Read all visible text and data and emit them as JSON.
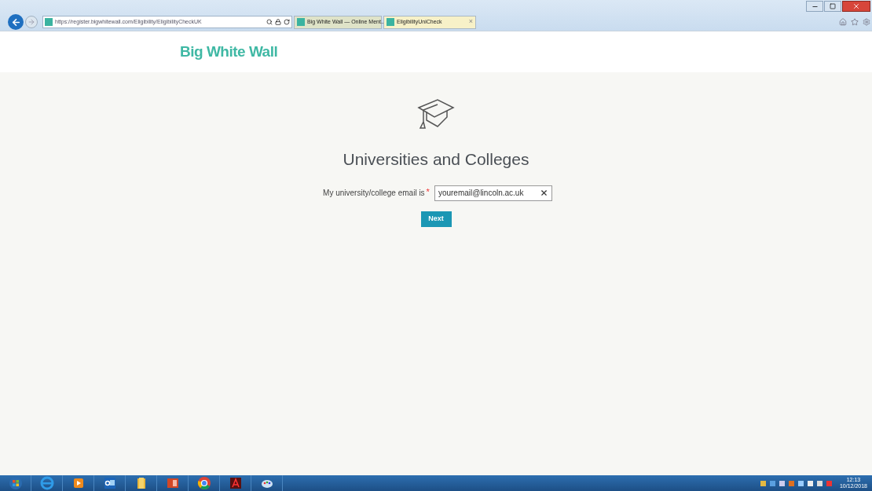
{
  "browser": {
    "address": "https://register.bigwhitewall.com/Eligibility/EligibilityCheckUK",
    "tabs": [
      {
        "label": "Big White Wall — Online Ment...",
        "selected": false
      },
      {
        "label": "EligibilityUniCheck",
        "selected": true,
        "close": "×"
      }
    ]
  },
  "header": {
    "logo": "Big White Wall"
  },
  "form": {
    "title": "Universities and Colleges",
    "label": "My university/college email is",
    "required": "*",
    "value": "youremail@lincoln.ac.uk",
    "button": "Next"
  },
  "taskbar": {
    "apps": [
      {
        "kind": "start"
      },
      {
        "kind": "ie"
      },
      {
        "kind": "media"
      },
      {
        "kind": "outlook"
      },
      {
        "kind": "folder"
      },
      {
        "kind": "powerpoint"
      },
      {
        "kind": "chrome"
      },
      {
        "kind": "acrobat"
      },
      {
        "kind": "paint"
      }
    ],
    "time": "12:13",
    "date": "10/12/2018"
  }
}
